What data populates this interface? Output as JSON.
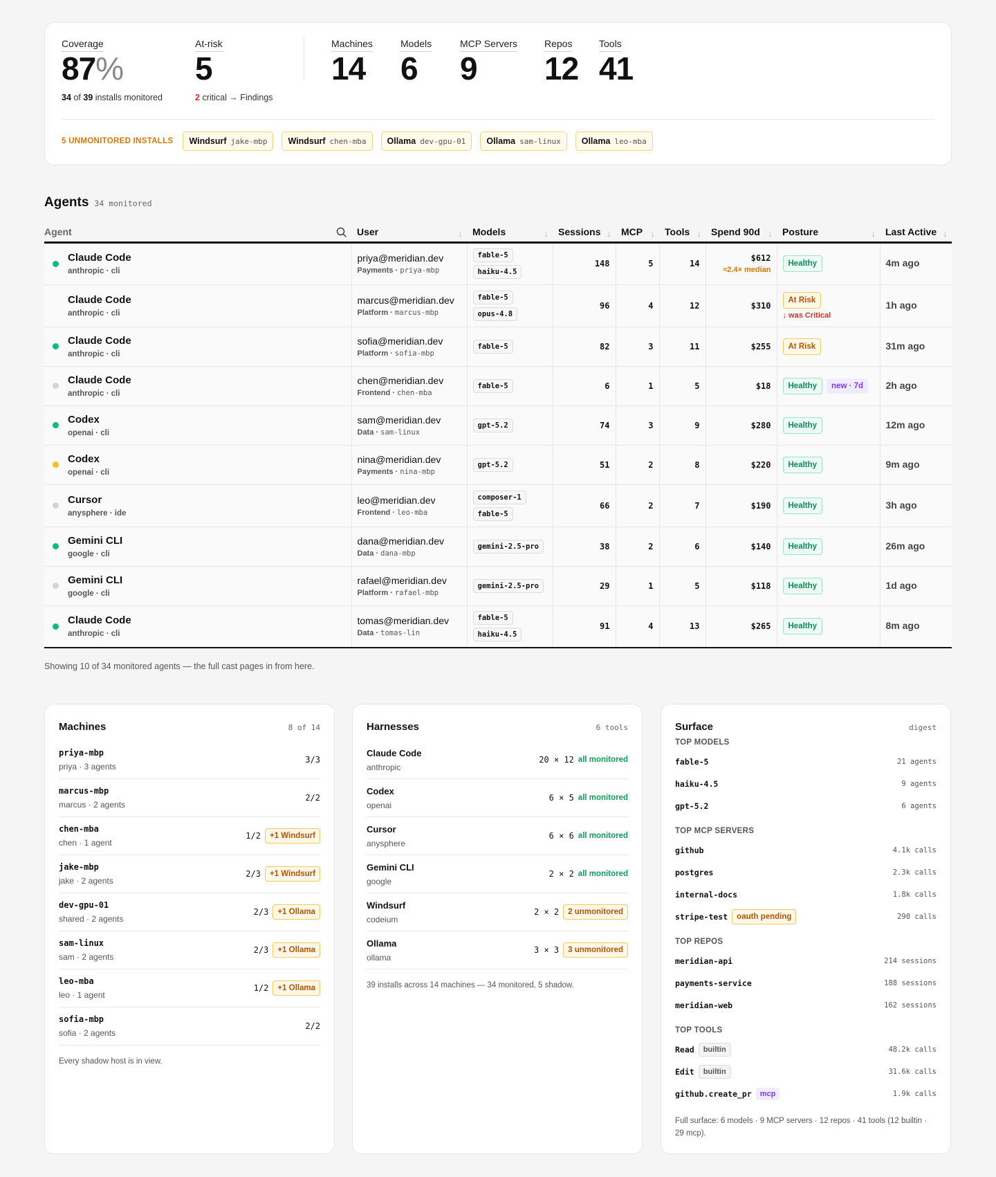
{
  "summary": {
    "coverage": {
      "label": "Coverage",
      "value": "87",
      "unit": "%",
      "sub_a": "34",
      "sub_of": "of",
      "sub_b": "39",
      "sub_rest": "installs monitored"
    },
    "at_risk": {
      "label": "At-risk",
      "value": "5",
      "sub_count": "2",
      "sub_rest": "critical → Findings"
    },
    "counts": [
      {
        "label": "Machines",
        "value": "14"
      },
      {
        "label": "Models",
        "value": "6"
      },
      {
        "label": "MCP Servers",
        "value": "9"
      },
      {
        "label": "Repos",
        "value": "12"
      },
      {
        "label": "Tools",
        "value": "41"
      }
    ],
    "unmonitored_label": "5 UNMONITORED INSTALLS",
    "unmonitored": [
      {
        "tool": "Windsurf",
        "host": "jake-mbp"
      },
      {
        "tool": "Windsurf",
        "host": "chen-mba"
      },
      {
        "tool": "Ollama",
        "host": "dev-gpu-01"
      },
      {
        "tool": "Ollama",
        "host": "sam-linux"
      },
      {
        "tool": "Ollama",
        "host": "leo-mba"
      }
    ]
  },
  "agents": {
    "title": "Agents",
    "count_label": "34 monitored",
    "columns": [
      "Agent",
      "User",
      "Models",
      "Sessions",
      "MCP",
      "Tools",
      "Spend 90d",
      "Posture",
      "Last Active"
    ],
    "rows": [
      {
        "status": "green",
        "name": "Claude Code",
        "vendor": "anthropic · cli",
        "email": "priya@meridian.dev",
        "team": "Payments",
        "host": "priya-mbp",
        "models": [
          "fable-5",
          "haiku-4.5"
        ],
        "sessions": "148",
        "mcp": "5",
        "tools": "14",
        "spend": "$612",
        "spend_note": "≈2.4× median",
        "posture": "Healthy",
        "posture_note": "",
        "tag": "",
        "last": "4m ago"
      },
      {
        "status": "none",
        "name": "Claude Code",
        "vendor": "anthropic · cli",
        "email": "marcus@meridian.dev",
        "team": "Platform",
        "host": "marcus-mbp",
        "models": [
          "fable-5",
          "opus-4.8"
        ],
        "sessions": "96",
        "mcp": "4",
        "tools": "12",
        "spend": "$310",
        "spend_note": "",
        "posture": "At Risk",
        "posture_note": "↓ was Critical",
        "tag": "",
        "last": "1h ago"
      },
      {
        "status": "green",
        "name": "Claude Code",
        "vendor": "anthropic · cli",
        "email": "sofia@meridian.dev",
        "team": "Platform",
        "host": "sofia-mbp",
        "models": [
          "fable-5"
        ],
        "sessions": "82",
        "mcp": "3",
        "tools": "11",
        "spend": "$255",
        "spend_note": "",
        "posture": "At Risk",
        "posture_note": "",
        "tag": "",
        "last": "31m ago"
      },
      {
        "status": "gray",
        "name": "Claude Code",
        "vendor": "anthropic · cli",
        "email": "chen@meridian.dev",
        "team": "Frontend",
        "host": "chen-mba",
        "models": [
          "fable-5"
        ],
        "sessions": "6",
        "mcp": "1",
        "tools": "5",
        "spend": "$18",
        "spend_note": "",
        "posture": "Healthy",
        "posture_note": "",
        "tag": "new · 7d",
        "last": "2h ago"
      },
      {
        "status": "green",
        "name": "Codex",
        "vendor": "openai · cli",
        "email": "sam@meridian.dev",
        "team": "Data",
        "host": "sam-linux",
        "models": [
          "gpt-5.2"
        ],
        "sessions": "74",
        "mcp": "3",
        "tools": "9",
        "spend": "$280",
        "spend_note": "",
        "posture": "Healthy",
        "posture_note": "",
        "tag": "",
        "last": "12m ago"
      },
      {
        "status": "yellow",
        "name": "Codex",
        "vendor": "openai · cli",
        "email": "nina@meridian.dev",
        "team": "Payments",
        "host": "nina-mbp",
        "models": [
          "gpt-5.2"
        ],
        "sessions": "51",
        "mcp": "2",
        "tools": "8",
        "spend": "$220",
        "spend_note": "",
        "posture": "Healthy",
        "posture_note": "",
        "tag": "",
        "last": "9m ago"
      },
      {
        "status": "gray",
        "name": "Cursor",
        "vendor": "anysphere · ide",
        "email": "leo@meridian.dev",
        "team": "Frontend",
        "host": "leo-mba",
        "models": [
          "composer-1",
          "fable-5"
        ],
        "sessions": "66",
        "mcp": "2",
        "tools": "7",
        "spend": "$190",
        "spend_note": "",
        "posture": "Healthy",
        "posture_note": "",
        "tag": "",
        "last": "3h ago"
      },
      {
        "status": "green",
        "name": "Gemini CLI",
        "vendor": "google · cli",
        "email": "dana@meridian.dev",
        "team": "Data",
        "host": "dana-mbp",
        "models": [
          "gemini-2.5-pro"
        ],
        "sessions": "38",
        "mcp": "2",
        "tools": "6",
        "spend": "$140",
        "spend_note": "",
        "posture": "Healthy",
        "posture_note": "",
        "tag": "",
        "last": "26m ago"
      },
      {
        "status": "gray",
        "name": "Gemini CLI",
        "vendor": "google · cli",
        "email": "rafael@meridian.dev",
        "team": "Platform",
        "host": "rafael-mbp",
        "models": [
          "gemini-2.5-pro"
        ],
        "sessions": "29",
        "mcp": "1",
        "tools": "5",
        "spend": "$118",
        "spend_note": "",
        "posture": "Healthy",
        "posture_note": "",
        "tag": "",
        "last": "1d ago"
      },
      {
        "status": "green",
        "name": "Claude Code",
        "vendor": "anthropic · cli",
        "email": "tomas@meridian.dev",
        "team": "Data",
        "host": "tomas-lin",
        "models": [
          "fable-5",
          "haiku-4.5"
        ],
        "sessions": "91",
        "mcp": "4",
        "tools": "13",
        "spend": "$265",
        "spend_note": "",
        "posture": "Healthy",
        "posture_note": "",
        "tag": "",
        "last": "8m ago"
      }
    ],
    "footer": "Showing 10 of 34 monitored agents — the full cast pages in from here."
  },
  "machines": {
    "title": "Machines",
    "count": "8 of 14",
    "rows": [
      {
        "name": "priya-mbp",
        "sub": "priya · 3 agents",
        "ratio": "3/3",
        "extra": ""
      },
      {
        "name": "marcus-mbp",
        "sub": "marcus · 2 agents",
        "ratio": "2/2",
        "extra": ""
      },
      {
        "name": "chen-mba",
        "sub": "chen · 1 agent",
        "ratio": "1/2",
        "extra": "+1 Windsurf"
      },
      {
        "name": "jake-mbp",
        "sub": "jake · 2 agents",
        "ratio": "2/3",
        "extra": "+1 Windsurf"
      },
      {
        "name": "dev-gpu-01",
        "sub": "shared · 2 agents",
        "ratio": "2/3",
        "extra": "+1 Ollama"
      },
      {
        "name": "sam-linux",
        "sub": "sam · 2 agents",
        "ratio": "2/3",
        "extra": "+1 Ollama"
      },
      {
        "name": "leo-mba",
        "sub": "leo · 1 agent",
        "ratio": "1/2",
        "extra": "+1 Ollama"
      },
      {
        "name": "sofia-mbp",
        "sub": "sofia · 2 agents",
        "ratio": "2/2",
        "extra": ""
      }
    ],
    "footer": "Every shadow host is in view."
  },
  "harnesses": {
    "title": "Harnesses",
    "count": "6 tools",
    "rows": [
      {
        "name": "Claude Code",
        "vendor": "anthropic",
        "dims": "20 × 12",
        "status": "all monitored",
        "warn": false
      },
      {
        "name": "Codex",
        "vendor": "openai",
        "dims": "6 × 5",
        "status": "all monitored",
        "warn": false
      },
      {
        "name": "Cursor",
        "vendor": "anysphere",
        "dims": "6 × 6",
        "status": "all monitored",
        "warn": false
      },
      {
        "name": "Gemini CLI",
        "vendor": "google",
        "dims": "2 × 2",
        "status": "all monitored",
        "warn": false
      },
      {
        "name": "Windsurf",
        "vendor": "codeium",
        "dims": "2 × 2",
        "status": "2 unmonitored",
        "warn": true
      },
      {
        "name": "Ollama",
        "vendor": "ollama",
        "dims": "3 × 3",
        "status": "3 unmonitored",
        "warn": true
      }
    ],
    "footer": "39 installs across 14 machines — 34 monitored, 5 shadow."
  },
  "surface": {
    "title": "Surface",
    "count": "digest",
    "sections": [
      {
        "title": "TOP MODELS",
        "rows": [
          {
            "name": "fable-5",
            "chip": "",
            "chip_kind": "",
            "value": "21 agents"
          },
          {
            "name": "haiku-4.5",
            "chip": "",
            "chip_kind": "",
            "value": "9 agents"
          },
          {
            "name": "gpt-5.2",
            "chip": "",
            "chip_kind": "",
            "value": "6 agents"
          }
        ]
      },
      {
        "title": "TOP MCP SERVERS",
        "rows": [
          {
            "name": "github",
            "chip": "",
            "chip_kind": "",
            "value": "4.1k calls"
          },
          {
            "name": "postgres",
            "chip": "",
            "chip_kind": "",
            "value": "2.3k calls"
          },
          {
            "name": "internal-docs",
            "chip": "",
            "chip_kind": "",
            "value": "1.8k calls"
          },
          {
            "name": "stripe-test",
            "chip": "oauth pending",
            "chip_kind": "warn",
            "value": "290 calls"
          }
        ]
      },
      {
        "title": "TOP REPOS",
        "rows": [
          {
            "name": "meridian-api",
            "chip": "",
            "chip_kind": "",
            "value": "214 sessions"
          },
          {
            "name": "payments-service",
            "chip": "",
            "chip_kind": "",
            "value": "188 sessions"
          },
          {
            "name": "meridian-web",
            "chip": "",
            "chip_kind": "",
            "value": "162 sessions"
          }
        ]
      },
      {
        "title": "TOP TOOLS",
        "rows": [
          {
            "name": "Read",
            "chip": "builtin",
            "chip_kind": "gray",
            "value": "48.2k calls"
          },
          {
            "name": "Edit",
            "chip": "builtin",
            "chip_kind": "gray",
            "value": "31.6k calls"
          },
          {
            "name": "github.create_pr",
            "chip": "mcp",
            "chip_kind": "purple",
            "value": "1.9k calls"
          }
        ]
      }
    ],
    "footer": "Full surface: 6 models · 9 MCP servers · 12 repos · 41 tools (12 builtin · 29 mcp)."
  },
  "colors": {
    "green": "#10b981",
    "yellow": "#fbbf24",
    "gray": "#d4d4d4",
    "accent_orange": "#d97706",
    "critical_red": "#d92d20"
  }
}
